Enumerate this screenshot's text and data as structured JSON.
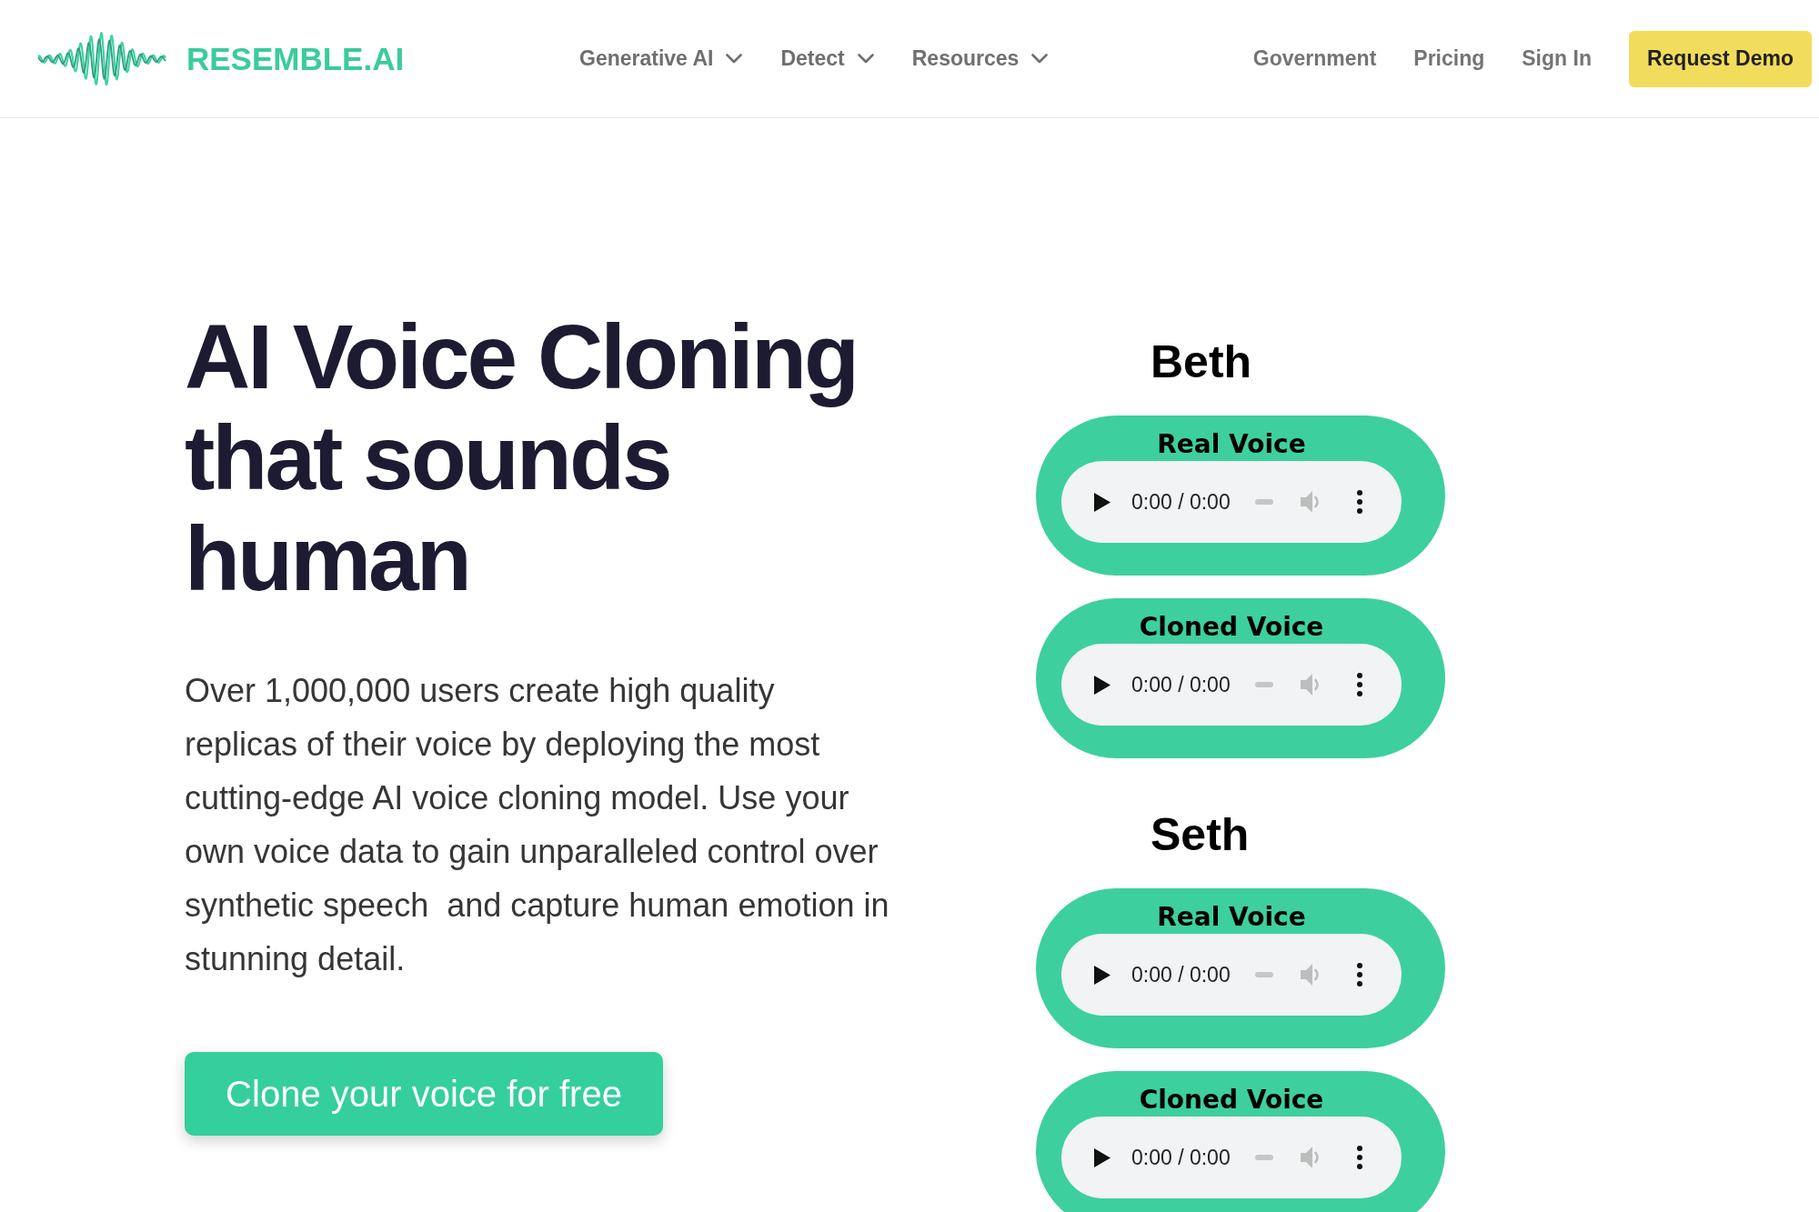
{
  "header": {
    "brand": "RESEMBLE.AI",
    "nav_menus": [
      "Generative AI",
      "Detect",
      "Resources"
    ],
    "nav_links": [
      "Government",
      "Pricing",
      "Sign In"
    ],
    "cta_button": "Request Demo"
  },
  "hero": {
    "title": "AI Voice Cloning that sounds human",
    "description": "Over 1,000,000 users create high quality replicas of their voice by deploying the most cutting-edge AI voice cloning model. Use your own voice data to gain unparalleled control over synthetic speech  and capture human emotion in stunning detail.",
    "button": "Clone your voice for free"
  },
  "voice_samples": [
    {
      "speaker": "Beth",
      "players": [
        {
          "label": "Real Voice",
          "time": "0:00 / 0:00"
        },
        {
          "label": "Cloned Voice",
          "time": "0:00 / 0:00"
        }
      ]
    },
    {
      "speaker": "Seth",
      "players": [
        {
          "label": "Real Voice",
          "time": "0:00 / 0:00"
        },
        {
          "label": "Cloned Voice",
          "time": "0:00 / 0:00"
        }
      ]
    }
  ]
}
